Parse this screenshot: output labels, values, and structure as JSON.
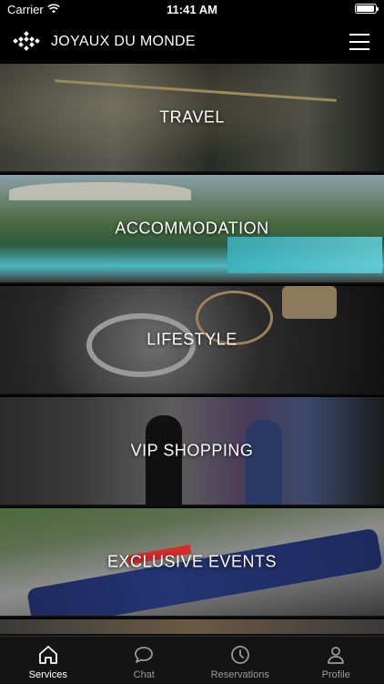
{
  "status_bar": {
    "carrier": "Carrier",
    "time": "11:41 AM",
    "battery_level": 0.95
  },
  "header": {
    "brand": "JOYAUX DU MONDE"
  },
  "tiles": [
    {
      "label": "TRAVEL"
    },
    {
      "label": "ACCOMMODATION"
    },
    {
      "label": "LIFESTYLE"
    },
    {
      "label": "VIP SHOPPING"
    },
    {
      "label": "EXCLUSIVE EVENTS"
    },
    {
      "label": ""
    }
  ],
  "tabs": [
    {
      "label": "Services",
      "icon": "home-icon",
      "active": true
    },
    {
      "label": "Chat",
      "icon": "chat-bubble-icon",
      "active": false
    },
    {
      "label": "Reservations",
      "icon": "clock-icon",
      "active": false
    },
    {
      "label": "Profile",
      "icon": "person-icon",
      "active": false
    }
  ]
}
